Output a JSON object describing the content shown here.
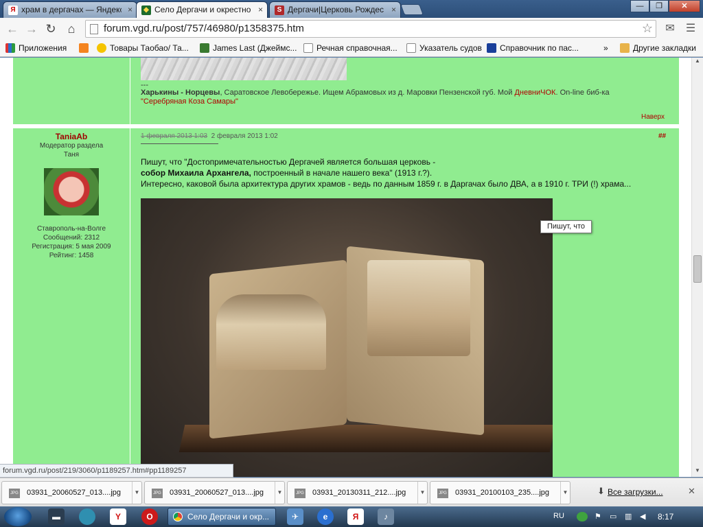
{
  "tabs": [
    {
      "title": "храм в дергачах — Яндекс",
      "icon": "Я",
      "icon_color": "#cc0000"
    },
    {
      "title": "Село Дергачи и окрестно",
      "icon": "V",
      "icon_color": "#1d6b2d"
    },
    {
      "title": "Дергачи|Церковь Рождес",
      "icon": "S",
      "icon_color": "#b0282a"
    }
  ],
  "window_controls": [
    "—",
    "❐",
    "✕"
  ],
  "url": "forum.vgd.ru/post/757/46980/p1358375.htm",
  "bookmarks": [
    {
      "label": "Приложения",
      "icon": "grid-icon",
      "color": "#2a6fc9"
    },
    {
      "label": "",
      "icon": "odnoklassniki-icon",
      "color": "#f48420"
    },
    {
      "label": "Товары Таобао/ Та...",
      "icon": "taobao-icon",
      "color": "#f5c400"
    },
    {
      "label": "James Last (Джеймс...",
      "icon": "music-icon",
      "color": "#3a7a30"
    },
    {
      "label": "Речная справочная...",
      "icon": "page-icon",
      "color": "#ffffff"
    },
    {
      "label": "Указатель судов",
      "icon": "page-icon",
      "color": "#ffffff"
    },
    {
      "label": "Справочник по пас...",
      "icon": "old-river-icon",
      "color": "#1a3f9a"
    },
    {
      "label": "»",
      "icon": "",
      "color": ""
    },
    {
      "label": "Другие закладки",
      "icon": "folder-icon",
      "color": "#e8b34a"
    }
  ],
  "prev_post": {
    "dash": "---",
    "sig_names": "Харькины - Норцевы",
    "sig_text": ", Саратовское Левобережье. Ищем Абрамовых из д. Маровки Пензенской губ. Мой ",
    "sig_diary": "ДневниЧОК",
    "sig_text2": ". On-line биб-ка ",
    "sig_library": "\"Серебряная Коза Самары\"",
    "top_link": "Наверх"
  },
  "user": {
    "name": "TaniaAb",
    "role": "Модератор раздела",
    "realname": "Таня",
    "city": "Ставрополь-на-Волге",
    "posts": "Сообщений: 2312",
    "registered": "Регистрация: 5 мая 2009",
    "rating": "Рейтинг: 1458"
  },
  "post": {
    "date_old": "1 февраля 2013 1:03",
    "date_new": "2 февраля 2013 1:02",
    "anchor": "##",
    "line1": "Пишут, что \"Достопримечательностью Дергачей является большая церковь -",
    "line2_bold": "собор Михаила Архангела,",
    "line2_rest": " построенный в начале нашего века\" (1913 г.?).",
    "line3": "Интересно, каковой была архитектура других храмов - ведь по данным 1859 г. в Даргачах было ДВА, а в 1910 г. ТРИ (!) храма..."
  },
  "tooltip": "Пишут, что",
  "status_url": "forum.vgd.ru/post/219/3060/p1189257.htm#pp1189257",
  "downloads": [
    {
      "name": "03931_20060527_013....jpg"
    },
    {
      "name": "03931_20060527_013....jpg"
    },
    {
      "name": "03931_20130311_212....jpg"
    },
    {
      "name": "03931_20100103_235....jpg"
    }
  ],
  "all_downloads": "Все загрузки...",
  "taskbar": {
    "active_task": "Село Дергачи и окр...",
    "lang": "RU",
    "clock": "8:17"
  }
}
